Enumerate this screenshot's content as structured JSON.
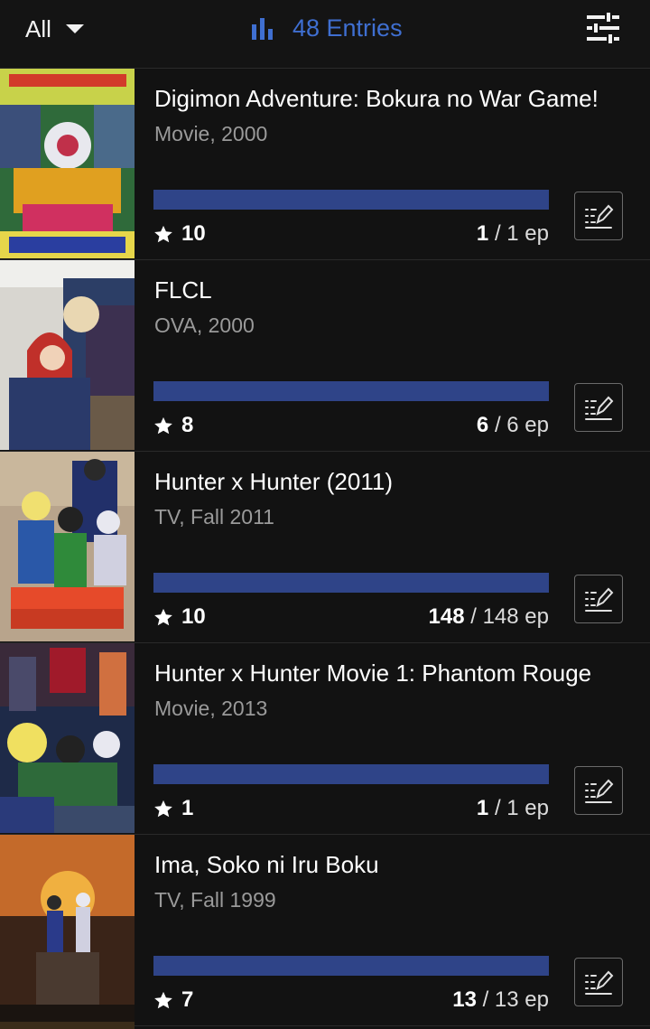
{
  "toolbar": {
    "filter_label": "All",
    "entries_label": "48 Entries"
  },
  "colors": {
    "accent": "#3f6fd1",
    "progress_bar": "#2f4488",
    "background": "#121212"
  },
  "entries": [
    {
      "title": "Digimon Adventure: Bokura no War Game!",
      "subtitle": "Movie, 2000",
      "score": "10",
      "watched": "1",
      "total": "/ 1 ep",
      "progress": 1.0
    },
    {
      "title": "FLCL",
      "subtitle": "OVA, 2000",
      "score": "8",
      "watched": "6",
      "total": "/ 6 ep",
      "progress": 1.0
    },
    {
      "title": "Hunter x Hunter (2011)",
      "subtitle": "TV, Fall 2011",
      "score": "10",
      "watched": "148",
      "total": "/ 148 ep",
      "progress": 1.0
    },
    {
      "title": "Hunter x Hunter Movie 1: Phantom Rouge",
      "subtitle": "Movie, 2013",
      "score": "1",
      "watched": "1",
      "total": "/ 1 ep",
      "progress": 1.0
    },
    {
      "title": "Ima, Soko ni Iru Boku",
      "subtitle": "TV, Fall 1999",
      "score": "7",
      "watched": "13",
      "total": "/ 13 ep",
      "progress": 1.0
    }
  ]
}
